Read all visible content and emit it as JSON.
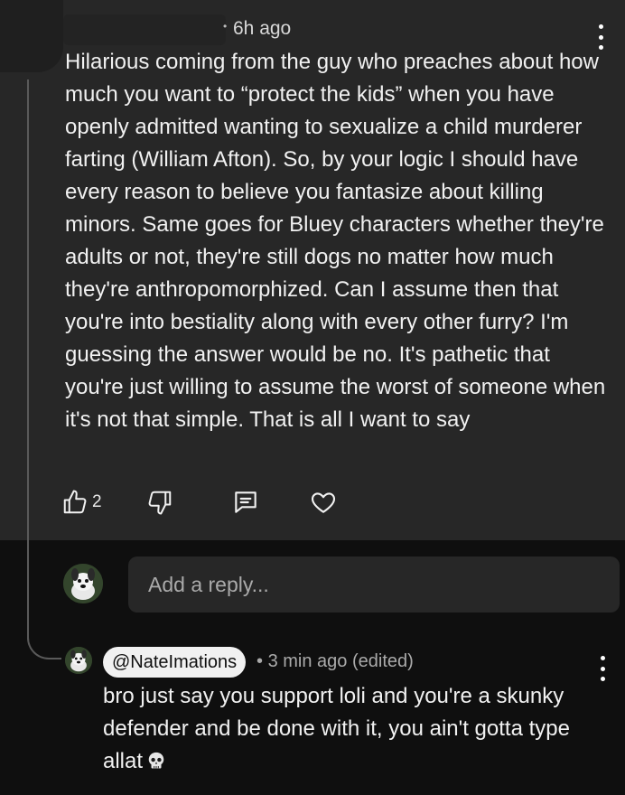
{
  "parent_comment": {
    "timestamp": "6h ago",
    "text": "Hilarious coming from the guy who preaches about how much you want to “protect the kids” when you have openly admitted wanting to sexualize a child murderer farting (William Afton). So, by your logic I should have every reason to believe you fantasize about killing minors. Same goes for Bluey characters whether they're adults or not, they're still dogs no matter how much they're anthropomorphized. Can I assume then that you're into bestiality along with every other furry? I'm guessing the answer would be no. It's pathetic that you're just willing to assume the worst of someone when it's not that simple. That is all I want to say",
    "like_count": "2"
  },
  "reply_input": {
    "placeholder": "Add a reply..."
  },
  "reply_comment": {
    "author_handle": "@NateImations",
    "separator": "•",
    "meta": "3 min ago (edited)",
    "text": "bro just say you support loli and you're a skunky defender and be done with it, you ain't gotta type allat"
  },
  "icons": {
    "like": "thumbs-up-icon",
    "dislike": "thumbs-down-icon",
    "reply": "comment-icon",
    "heart": "heart-icon",
    "menu": "more-vert-icon",
    "emoji": "skull-emoji"
  },
  "colors": {
    "background": "#0f0f0f",
    "highlight": "#272727",
    "text": "#f1f1f1",
    "secondary_text": "#aaaaaa"
  }
}
